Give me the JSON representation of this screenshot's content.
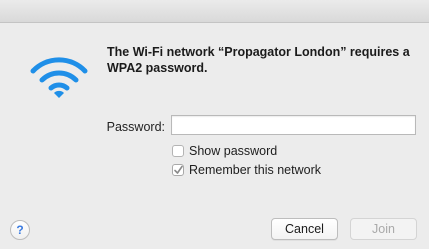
{
  "dialog": {
    "message": "The Wi-Fi network “Propagator London” requires a WPA2 password.",
    "password_label": "Password:",
    "password_value": "",
    "show_password_label": "Show password",
    "show_password_checked": false,
    "remember_label": "Remember this network",
    "remember_checked": true,
    "help_label": "?",
    "cancel_label": "Cancel",
    "join_label": "Join",
    "join_enabled": false
  },
  "icons": {
    "wifi": "wifi-icon",
    "help": "help-icon",
    "check": "checkmark-icon"
  },
  "colors": {
    "accent": "#1f8fe8",
    "background": "#ececec",
    "disabled_text": "#a9a9a9"
  }
}
